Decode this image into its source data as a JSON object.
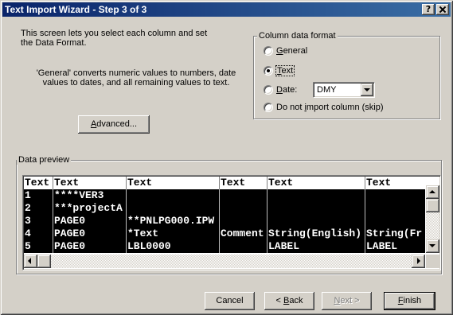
{
  "theme": {
    "title_bar_start": "#0a246a",
    "title_bar_end": "#3a6ea5",
    "face": "#d4d0c8",
    "selected_row_bg": "#000000",
    "selected_row_text": "#ffffff"
  },
  "title_bar": {
    "title": "Text Import Wizard - Step 3 of 3",
    "help_icon": "help-icon",
    "close_icon": "close-icon"
  },
  "intro": {
    "lines": [
      "This screen lets you select each column and set",
      "the Data Format."
    ]
  },
  "general_note": {
    "lines": [
      "'General' converts numeric values to numbers, date",
      "values to dates, and all remaining values to text."
    ]
  },
  "advanced_button": {
    "label": "Advanced..."
  },
  "column_format": {
    "legend": "Column data format",
    "options": [
      {
        "label": "General",
        "selected": false
      },
      {
        "label": "Text",
        "selected": true
      },
      {
        "label": "Date:",
        "selected": false
      },
      {
        "label": "Do not import column (skip)",
        "selected": false
      }
    ],
    "date_format": {
      "value": "DMY",
      "icon": "chevron-down-icon"
    }
  },
  "preview": {
    "legend": "Data preview",
    "headers": [
      "Text",
      "Text",
      "Text",
      "Text",
      "Text",
      "Text"
    ],
    "rows": [
      [
        "1",
        "****VER3",
        "",
        "",
        "",
        ""
      ],
      [
        "2",
        "***projectA",
        "",
        "",
        "",
        ""
      ],
      [
        "3",
        "PAGE0",
        "**PNLPG000.IPW",
        "",
        "",
        ""
      ],
      [
        "4",
        "PAGE0",
        "*Text",
        "Comment",
        "String(English)",
        "String(Fr"
      ],
      [
        "5",
        "PAGE0",
        "LBL0000",
        "",
        "LABEL",
        "LABEL"
      ]
    ],
    "icons": {
      "scroll_up": "arrow-up-icon",
      "scroll_down": "arrow-down-icon",
      "scroll_left": "arrow-left-icon",
      "scroll_right": "arrow-right-icon"
    }
  },
  "footer": {
    "cancel": {
      "label": "Cancel",
      "enabled": true
    },
    "back": {
      "label": "< Back",
      "enabled": true
    },
    "next": {
      "label": "Next >",
      "enabled": false
    },
    "finish": {
      "label": "Finish",
      "enabled": true,
      "default": true
    }
  }
}
